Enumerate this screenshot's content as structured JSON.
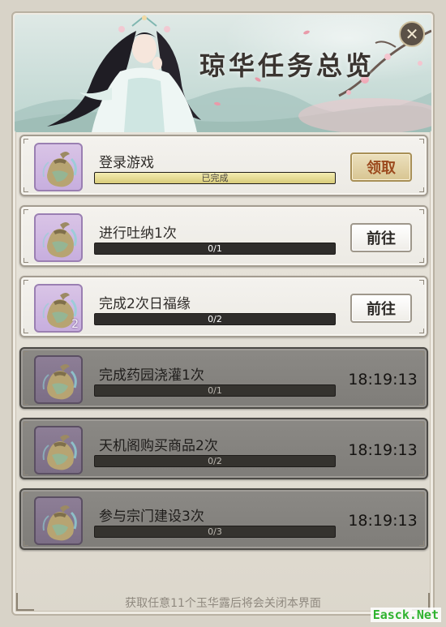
{
  "header": {
    "title": "琼华任务总览",
    "close_icon": "close-icon"
  },
  "tasks": [
    {
      "title": "登录游戏",
      "progress_text": "已完成",
      "progress": 1.0,
      "state": "claimable",
      "action_label": "领取",
      "reward_icon": "pouch-icon",
      "reward_count": ""
    },
    {
      "title": "进行吐纳1次",
      "progress_text": "0/1",
      "progress": 0,
      "state": "available",
      "action_label": "前往",
      "reward_icon": "pouch-icon",
      "reward_count": ""
    },
    {
      "title": "完成2次日福缘",
      "progress_text": "0/2",
      "progress": 0,
      "state": "available",
      "action_label": "前往",
      "reward_icon": "pouch-icon",
      "reward_count": "2"
    },
    {
      "title": "完成药园浇灌1次",
      "progress_text": "0/1",
      "progress": 0,
      "state": "locked",
      "timer": "18:19:13",
      "reward_icon": "pouch-icon",
      "reward_count": ""
    },
    {
      "title": "天机阁购买商品2次",
      "progress_text": "0/2",
      "progress": 0,
      "state": "locked",
      "timer": "18:19:13",
      "reward_icon": "pouch-icon",
      "reward_count": ""
    },
    {
      "title": "参与宗门建设3次",
      "progress_text": "0/3",
      "progress": 0,
      "state": "locked",
      "timer": "18:19:13",
      "reward_icon": "pouch-icon",
      "reward_count": ""
    }
  ],
  "footer": {
    "note": "获取任意11个玉华露后将会关闭本界面"
  },
  "watermark": "Easck.Net",
  "colors": {
    "claim_text": "#9c4a1e",
    "reward_bg": "#d9c4e6",
    "locked_bg": "#8b8985",
    "progress_fill": "#d9cc7a"
  }
}
